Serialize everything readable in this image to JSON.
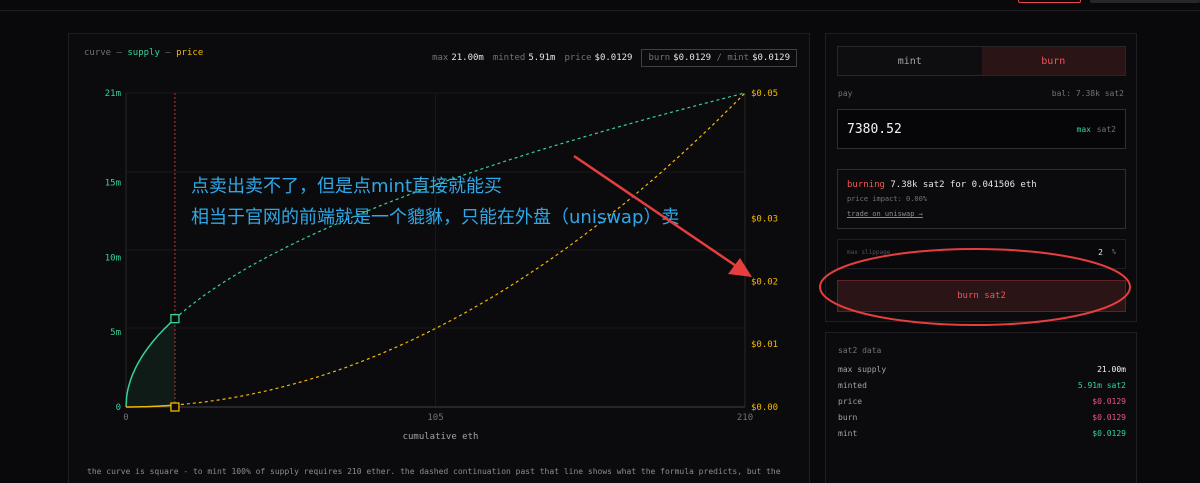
{
  "chart": {
    "legend": {
      "curve": "curve",
      "sep1": " — ",
      "supply": "supply",
      "sep2": " — ",
      "price": "price"
    },
    "stats": {
      "max_label": "max",
      "max_value": "21.00m",
      "minted_label": "minted",
      "minted_value": "5.91m",
      "price_label": "price",
      "price_value": "$0.0129",
      "burn_label": "burn",
      "burn_value": "$0.0129",
      "separator": "/",
      "mint_label": "mint",
      "mint_value": "$0.0129"
    },
    "footnote": "the curve is square - to mint 100% of supply requires 210 ether. the dashed continuation past that line shows what the formula predicts, but the"
  },
  "chart_data": {
    "type": "line",
    "xlabel": "cumulative eth",
    "x_ticks": [
      "0",
      "105",
      "210"
    ],
    "y_left_ticks": [
      "0",
      "5m",
      "10m",
      "15m",
      "21m"
    ],
    "y_right_ticks": [
      "$0.00",
      "$0.01",
      "$0.02",
      "$0.03",
      "$0.05"
    ],
    "xlim": [
      0,
      210
    ],
    "ylim_left": [
      0,
      21000000
    ],
    "ylim_right": [
      0,
      0.05
    ],
    "current_x": 16.6,
    "current_supply": 5910000,
    "current_price": 0.0129,
    "series": [
      {
        "name": "supply",
        "color": "#34d399",
        "axis": "left",
        "formula": "sqrt",
        "max": 21000000
      },
      {
        "name": "price",
        "color": "#f5b800",
        "axis": "right",
        "formula": "square",
        "max": 0.05
      }
    ],
    "grid": true
  },
  "panel": {
    "tabs": [
      {
        "label": "mint",
        "active": false
      },
      {
        "label": "burn",
        "active": true
      }
    ],
    "pay_label": "pay",
    "balance": "bal: 7.38k sat2",
    "pay_value": "7380.52",
    "max_label": "max",
    "unit": "sat2",
    "quote": {
      "action": "burning",
      "text": " 7.38k sat2 for ",
      "amount": "0.041506",
      "unit": " eth"
    },
    "price_impact": "price impact: 0.00%",
    "trade_link": "trade on uniswap →",
    "slippage_label": "max slippage",
    "slippage_value": "2",
    "slippage_unit": "%",
    "button": "burn sat2"
  },
  "data_panel": {
    "title": "sat2 data",
    "rows": [
      {
        "label": "max supply",
        "value": "21.00m"
      },
      {
        "label": "minted",
        "value": "5.91m sat2"
      },
      {
        "label": "price",
        "value": "$0.0129"
      },
      {
        "label": "burn",
        "value": "$0.0129"
      },
      {
        "label": "mint",
        "value": "$0.0129"
      }
    ]
  },
  "annotation": {
    "line1": "点卖出卖不了，但是点mint直接就能买",
    "line2": "相当于官网的前端就是一个貔貅，只能在外盘（uniswap）卖",
    "color": "#2ea8e8",
    "marker_color": "#e53e3e"
  }
}
